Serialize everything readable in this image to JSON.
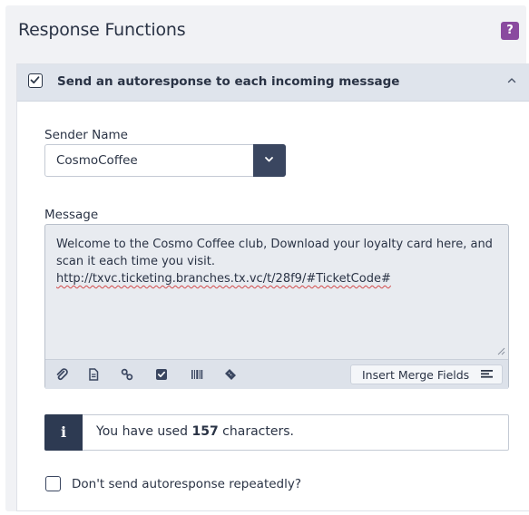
{
  "panel": {
    "title": "Response Functions",
    "help_label": "?"
  },
  "section": {
    "header_label": "Send an autoresponse to each incoming message",
    "header_checked": true
  },
  "sender": {
    "label": "Sender Name",
    "value": "CosmoCoffee"
  },
  "message": {
    "label": "Message",
    "line1": "Welcome to the Cosmo Coffee club, Download your loyalty card here, and scan it each time you visit.",
    "url": "http://txvc.ticketing.branches.tx.vc/t/28f9/#TicketCode#"
  },
  "toolbar": {
    "icons": [
      "paperclip-icon",
      "document-icon",
      "link-icon",
      "checkbox-icon",
      "barcode-icon",
      "ticket-icon"
    ],
    "merge_label": "Insert Merge Fields"
  },
  "info": {
    "icon_label": "i",
    "prefix": "You have used ",
    "count": "157",
    "suffix": " characters."
  },
  "repeat": {
    "label": "Don't send autoresponse repeatedly?",
    "checked": false
  },
  "colors": {
    "accent_dark": "#3a4660",
    "help_purple": "#8a4a9f",
    "header_bg": "#dfe4ec"
  }
}
